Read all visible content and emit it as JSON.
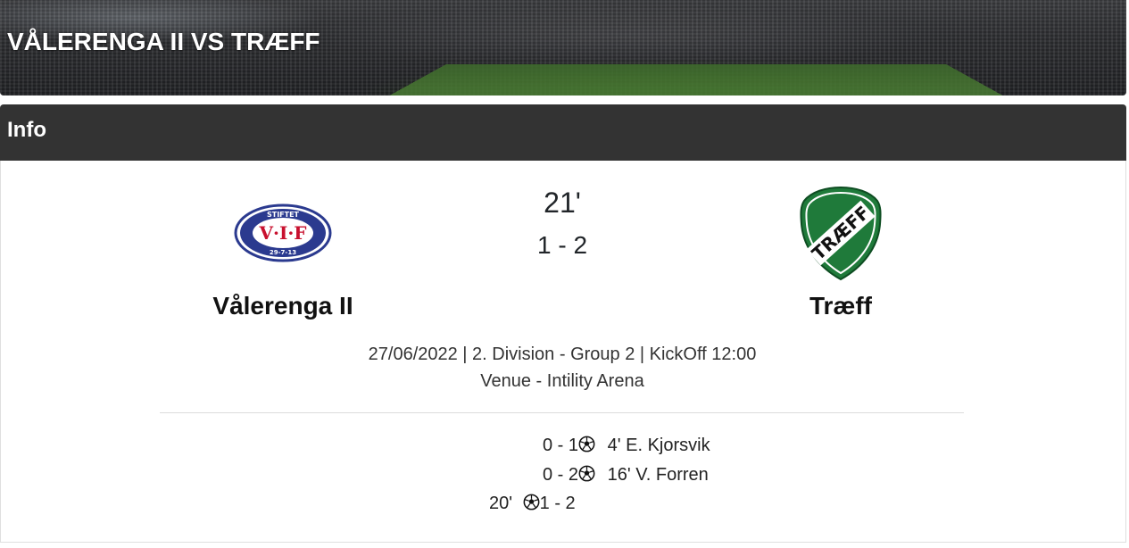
{
  "header": {
    "title": "VÅLERENGA II VS TRÆFF"
  },
  "info": {
    "title": "Info"
  },
  "match": {
    "minute": "21'",
    "score": "1 - 2",
    "home": {
      "name": "Vålerenga II",
      "crest": {
        "top_text": "STIFTET",
        "letters": "V·I·F",
        "bottom_text": "29-7-13",
        "color": "#2b3a8f"
      }
    },
    "away": {
      "name": "Træff",
      "crest": {
        "text": "TRÆFF",
        "color": "#1f7a3a"
      }
    },
    "meta_line": "27/06/2022 | 2. Division - Group 2 | KickOff 12:00",
    "venue_line": "Venue - Intility Arena"
  },
  "events": [
    {
      "score": "0 - 1",
      "minute": "4'",
      "player": "E. Kjorsvik",
      "side": "away",
      "icon": "soccer-ball-icon"
    },
    {
      "score": "0 - 2",
      "minute": "16'",
      "player": "V. Forren",
      "side": "away",
      "icon": "soccer-ball-icon"
    },
    {
      "score": "1 - 2",
      "minute": "20'",
      "player": "",
      "side": "home",
      "icon": "soccer-ball-icon"
    }
  ]
}
